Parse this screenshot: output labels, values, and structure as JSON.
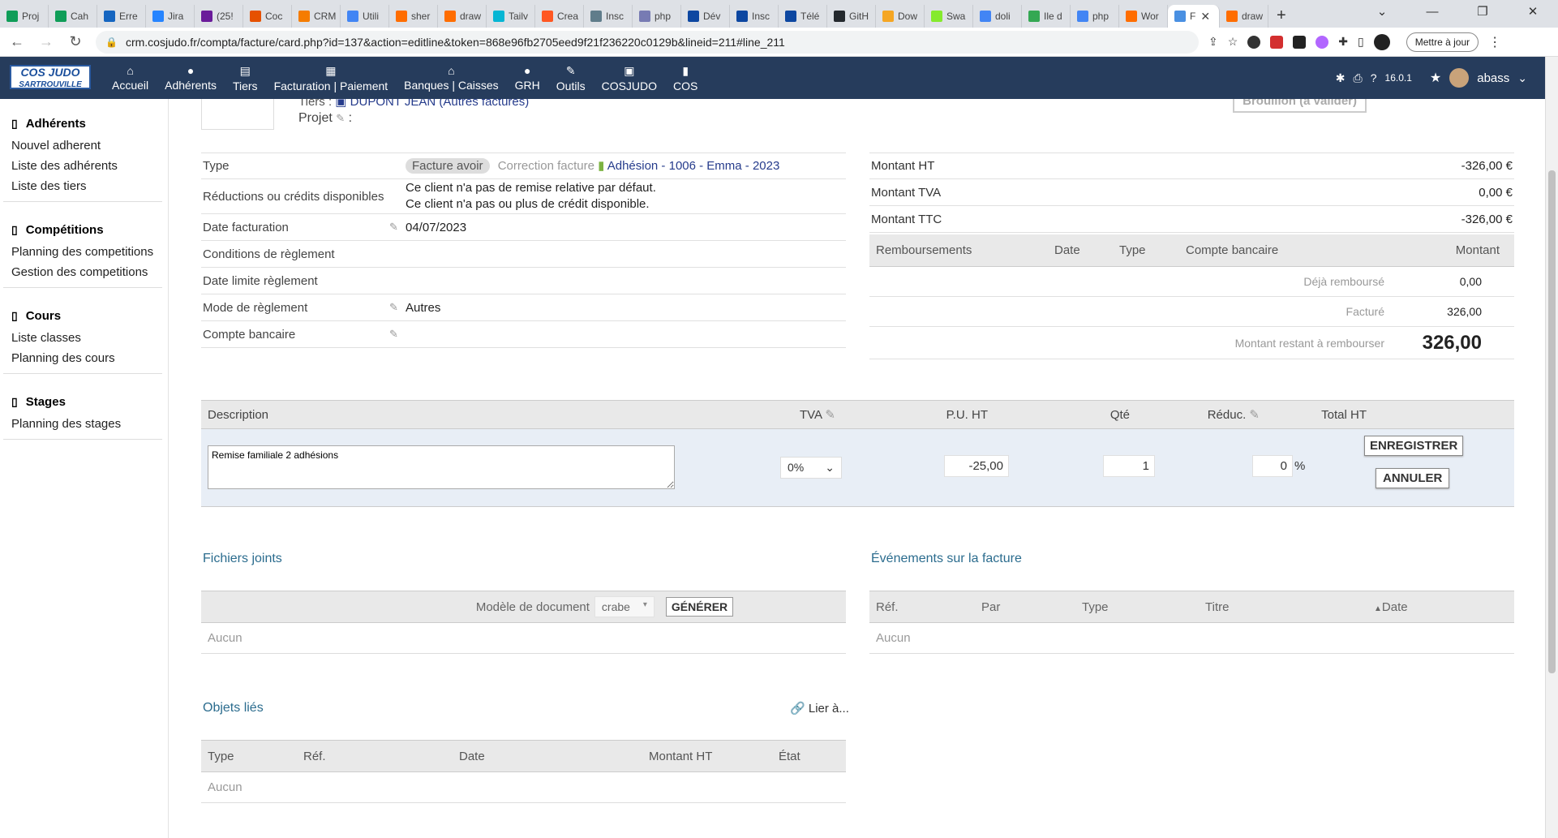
{
  "browser": {
    "tabs": [
      "Proj",
      "Cah",
      "Erre",
      "Jira",
      "(25!",
      "Coc",
      "CRM",
      "Utili",
      "sher",
      "draw",
      "Tailv",
      "Crea",
      "Insc",
      "php",
      "Dév",
      "Insc",
      "Télé",
      "GitH",
      "Dow",
      "Swa",
      "doli",
      "Ile d",
      "php",
      "Wor",
      "F",
      "draw"
    ],
    "active_tab_index": 24,
    "url": "crm.cosjudo.fr/compta/facture/card.php?id=137&action=editline&token=868e96fb2705eed9f21f236220c0129b&lineid=211#line_211",
    "update_button": "Mettre à jour"
  },
  "topmenu": {
    "logo": "COS JUDO SARTROUVILLE",
    "items": [
      "Accueil",
      "Adhérents",
      "Tiers",
      "Facturation | Paiement",
      "Banques | Caisses",
      "GRH",
      "Outils",
      "COSJUDO",
      "COS"
    ],
    "version": "16.0.1",
    "user": "abass"
  },
  "sidebar": {
    "sections": [
      {
        "title": "Adhérents",
        "items": [
          "Nouvel adherent",
          "Liste des adhérents",
          "Liste des tiers"
        ]
      },
      {
        "title": "Compétitions",
        "items": [
          "Planning des competitions",
          "Gestion des competitions"
        ]
      },
      {
        "title": "Cours",
        "items": [
          "Liste classes",
          "Planning des cours"
        ]
      },
      {
        "title": "Stages",
        "items": [
          "Planning des stages"
        ]
      }
    ]
  },
  "header": {
    "tiers_label": "Tiers :",
    "tiers_value": "DUPONT JEAN (Autres factures)",
    "projet_label": "Projet",
    "projet_sep": ":",
    "status": "Brouillon (à valider)"
  },
  "details": {
    "type_label": "Type",
    "type_badge": "Facture avoir",
    "correction_text": "Correction facture",
    "correction_link": "Adhésion - 1006 - Emma - 2023",
    "reductions_label": "Réductions ou crédits disponibles",
    "reductions_line1": "Ce client n'a pas de remise relative par défaut.",
    "reductions_line2": "Ce client n'a pas ou plus de crédit disponible.",
    "date_label": "Date facturation",
    "date_value": "04/07/2023",
    "conditions_label": "Conditions de règlement",
    "limit_label": "Date limite règlement",
    "mode_label": "Mode de règlement",
    "mode_value": "Autres",
    "account_label": "Compte bancaire"
  },
  "amounts": {
    "ht_label": "Montant HT",
    "ht_value": "-326,00 €",
    "tva_label": "Montant TVA",
    "tva_value": "0,00 €",
    "ttc_label": "Montant TTC",
    "ttc_value": "-326,00 €",
    "refund_headers": [
      "Remboursements",
      "Date",
      "Type",
      "Compte bancaire",
      "Montant"
    ],
    "already_label": "Déjà remboursé",
    "already_value": "0,00",
    "invoiced_label": "Facturé",
    "invoiced_value": "326,00",
    "remaining_label": "Montant restant à rembourser",
    "remaining_value": "326,00"
  },
  "lines": {
    "headers": {
      "description": "Description",
      "tva": "TVA",
      "pu": "P.U. HT",
      "qty": "Qté",
      "reduc": "Réduc.",
      "total": "Total HT"
    },
    "edit": {
      "description": "Remise familiale 2 adhésions",
      "tva": "0%",
      "pu": "-25,00",
      "qty": "1",
      "reduc": "0",
      "reduc_unit": "%",
      "save": "ENREGISTRER",
      "cancel": "ANNULER"
    }
  },
  "files": {
    "title": "Fichiers joints",
    "model_label": "Modèle de document",
    "model_value": "crabe",
    "generate": "GÉNÉRER",
    "empty": "Aucun"
  },
  "events": {
    "title": "Événements sur la facture",
    "headers": [
      "Réf.",
      "Par",
      "Type",
      "Titre",
      "Date"
    ],
    "empty": "Aucun"
  },
  "linked": {
    "title": "Objets liés",
    "link": "Lier à...",
    "headers": [
      "Type",
      "Réf.",
      "Date",
      "Montant HT",
      "État"
    ],
    "empty": "Aucun"
  }
}
